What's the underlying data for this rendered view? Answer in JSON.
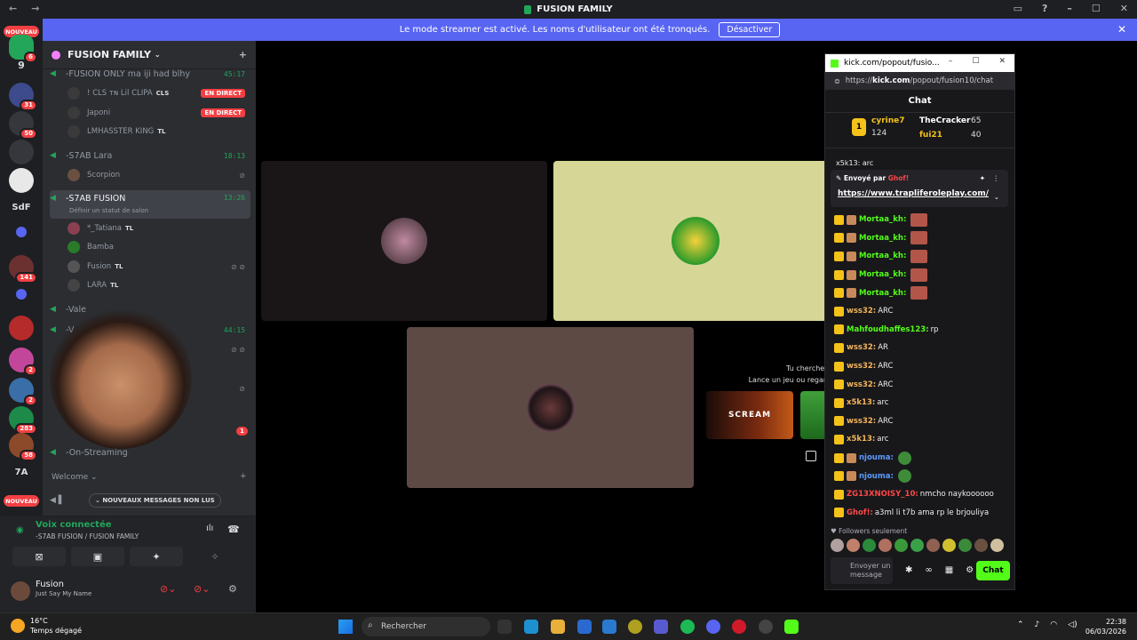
{
  "window": {
    "title": "FUSION FAMILY"
  },
  "streamer_banner": {
    "text": "Le mode streamer est activé. Les noms d'utilisateur ont été tronqués.",
    "button": "Désactiver"
  },
  "serverbar": {
    "new1": "NOUVEAU",
    "new2": "NOUVEAU",
    "items": [
      {
        "label": "9"
      },
      {
        "badge": "31"
      },
      {
        "badge": "50"
      },
      {
        "label": ""
      },
      {
        "label": ""
      },
      {
        "label": "SdF"
      },
      {
        "badge": "141"
      },
      {
        "label": ""
      },
      {
        "label": ""
      },
      {
        "badge": "2"
      },
      {
        "badge": "2"
      },
      {
        "badge": "283"
      },
      {
        "badge": "58"
      },
      {
        "label": "7A"
      }
    ],
    "top_badge": "6"
  },
  "server": {
    "name": "FUSION FAMILY"
  },
  "voice_channels": [
    {
      "name": "-FUSION ONLY ma iji had blhy",
      "time": "45:17"
    },
    {
      "name": "-S7AB Lara",
      "time": "18:13"
    },
    {
      "name": "-S7AB FUSION",
      "time": "13:26",
      "status": "Définir un statut de salon"
    },
    {
      "name": "-Vale",
      "time": ""
    },
    {
      "name": "-V",
      "time": "44:15"
    },
    {
      "name": "-On-Streaming",
      "time": ""
    }
  ],
  "users": [
    {
      "name": "! CLS ᴛɴ Lil CLIPA",
      "tag": "CLS",
      "live": "EN DIRECT"
    },
    {
      "name": "Japoni",
      "tag": "",
      "live": "EN DIRECT"
    },
    {
      "name": "LMHASSTER KING",
      "tag": "TL",
      "live": ""
    },
    {
      "name": "Scorpion",
      "tag": "",
      "live": ""
    },
    {
      "name": "*_Tatiana",
      "tag": "TL",
      "live": ""
    },
    {
      "name": "Bamba",
      "tag": "",
      "live": ""
    },
    {
      "name": "Fusion",
      "tag": "TL",
      "live": ""
    },
    {
      "name": "LARA",
      "tag": "TL",
      "live": ""
    }
  ],
  "welcome": "Welcome",
  "new_messages": "NOUVEAUX MESSAGES NON LUS",
  "mention_badge": "1",
  "voice_panel": {
    "title": "Voix connectée",
    "subtitle": "-S7AB FUSION / FUSION FAMILY"
  },
  "user_panel": {
    "name": "Fusion",
    "status": "Just Say My Name"
  },
  "stage": {
    "hint1": "Tu cherches q",
    "hint2": "Lance un jeu ou regarde",
    "game": "SCREAM"
  },
  "kick": {
    "tab": "kick.com/popout/fusio...",
    "url_pre": "https://",
    "url_host": "kick.com",
    "url_path": "/popout/fusion10/chat",
    "chat_title": "Chat",
    "leaders": [
      {
        "name": "cyrine7",
        "value": "124"
      },
      {
        "name": "TheCracker",
        "value": "65"
      },
      {
        "name": "fui21",
        "value": "40"
      }
    ],
    "top_text": "x5k13: arc",
    "pinned_by": "Envoyé par",
    "pinned_user": "Ghof!",
    "pinned_link": "https://www.trapliferoleplay.com/",
    "messages": [
      {
        "user": "Mortaa_kh:",
        "text": "",
        "color": "#53fc18",
        "emote": true
      },
      {
        "user": "Mortaa_kh:",
        "text": "",
        "color": "#53fc18",
        "emote": true
      },
      {
        "user": "Mortaa_kh:",
        "text": "",
        "color": "#53fc18",
        "emote": true
      },
      {
        "user": "Mortaa_kh:",
        "text": "",
        "color": "#53fc18",
        "emote": true
      },
      {
        "user": "Mortaa_kh:",
        "text": "",
        "color": "#53fc18",
        "emote": true
      },
      {
        "user": "wss32:",
        "text": "ARC",
        "color": "#f2b45b"
      },
      {
        "user": "Mahfoudhaffes123:",
        "text": "rp",
        "color": "#53fc18"
      },
      {
        "user": "wss32:",
        "text": "AR",
        "color": "#f2b45b"
      },
      {
        "user": "wss32:",
        "text": "ARC",
        "color": "#f2b45b"
      },
      {
        "user": "wss32:",
        "text": "ARC",
        "color": "#f2b45b"
      },
      {
        "user": "x5k13:",
        "text": "arc",
        "color": "#f2b45b"
      },
      {
        "user": "wss32:",
        "text": "ARC",
        "color": "#f2b45b"
      },
      {
        "user": "x5k13:",
        "text": "arc",
        "color": "#f2b45b"
      },
      {
        "user": "njouma:",
        "text": "",
        "color": "#5b9bff",
        "pepe": true
      },
      {
        "user": "njouma:",
        "text": "",
        "color": "#5b9bff",
        "pepe": true
      },
      {
        "user": "ZG13XNOISY_10:",
        "text": "nmcho naykoooooo",
        "color": "#ff4747"
      },
      {
        "user": "Ghof!:",
        "text": "a3ml li t7b ama rp le brjouliya",
        "color": "#ff4747"
      }
    ],
    "followers": "Followers seulement",
    "input_placeholder": "Envoyer un message",
    "send": "Chat"
  },
  "taskbar": {
    "temp": "16°C",
    "weather": "Temps dégagé",
    "search": "Rechercher",
    "time": "22:38",
    "date": "06/03/2026"
  }
}
